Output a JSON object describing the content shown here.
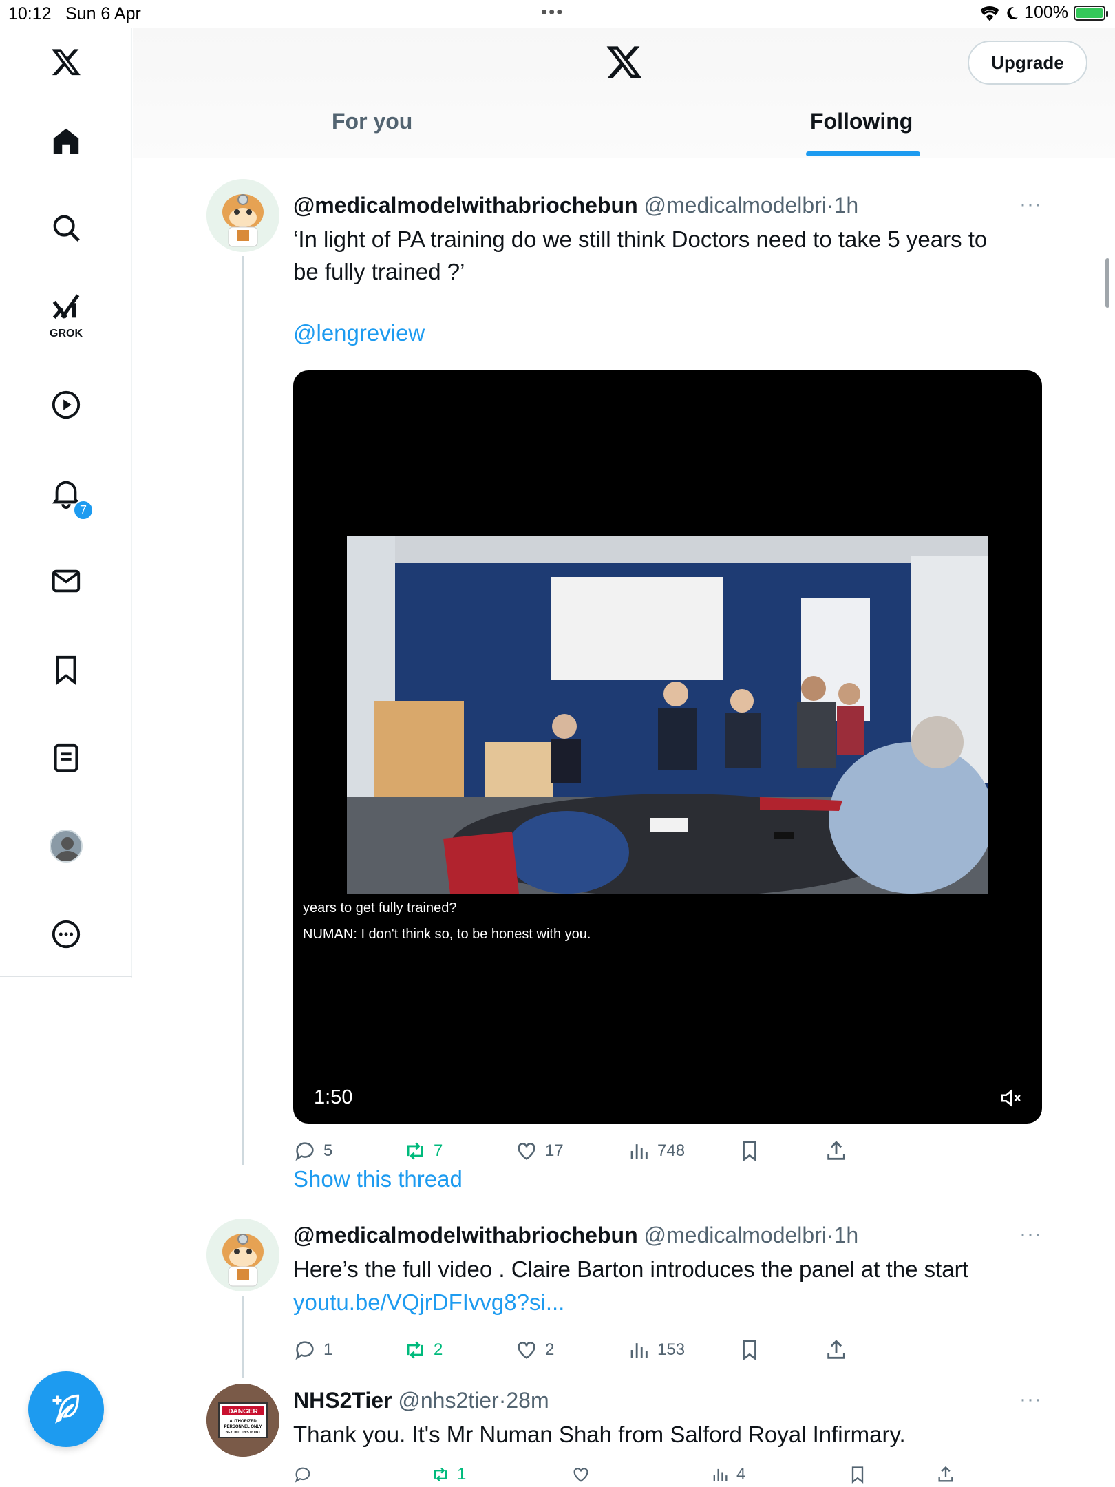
{
  "status_bar": {
    "time": "10:12",
    "date": "Sun 6 Apr",
    "dots": "•••",
    "battery": "100%"
  },
  "nav": {
    "grok_label": "GROK",
    "notification_count": "7",
    "icons": [
      "x-logo-icon",
      "home-icon",
      "search-icon",
      "grok-icon",
      "video-play-icon",
      "bell-icon",
      "mail-icon",
      "bookmark-icon",
      "list-icon",
      "profile-icon",
      "more-icon",
      "compose-icon"
    ]
  },
  "header": {
    "upgrade_label": "Upgrade",
    "tabs": [
      {
        "label": "For you",
        "active": false
      },
      {
        "label": "Following",
        "active": true
      }
    ],
    "accent_color": "#1d9bf0"
  },
  "tweets": [
    {
      "name": "@medicalmodelwithabriochebun",
      "handle": "@medicalmodelbri",
      "sep": "·",
      "time": "1h",
      "more": "···",
      "text_line1": "‘In light of PA training do we still think Doctors need to take 5 years to",
      "text_line2": "be fully trained ?’",
      "mention": "@lengreview",
      "video": {
        "caption1": "years to get fully trained?",
        "caption2": "NUMAN:  I don't think so, to be honest with you.",
        "duration": "1:50"
      },
      "replies": "5",
      "reposts": "7",
      "likes": "17",
      "views": "748",
      "show_thread": "Show this thread"
    },
    {
      "name": "@medicalmodelwithabriochebun",
      "handle": "@medicalmodelbri",
      "sep": "·",
      "time": "1h",
      "more": "···",
      "text": "Here’s the full video . Claire Barton introduces the panel at the start",
      "link": "youtu.be/VQjrDFIvvg8?si...",
      "replies": "1",
      "reposts": "2",
      "likes": "2",
      "views": "153"
    },
    {
      "name": "NHS2Tier",
      "handle": "@nhs2tier",
      "sep": "·",
      "time": "28m",
      "more": "···",
      "text": "Thank you. It's Mr Numan Shah from Salford Royal Infirmary.",
      "avatar_sign": {
        "line1": "DANGER",
        "line2": "AUTHORIZED",
        "line3": "PERSONNEL ONLY",
        "line4": "BEYOND THIS POINT"
      },
      "replies": "",
      "reposts": "1",
      "likes": "",
      "views": "4"
    }
  ]
}
